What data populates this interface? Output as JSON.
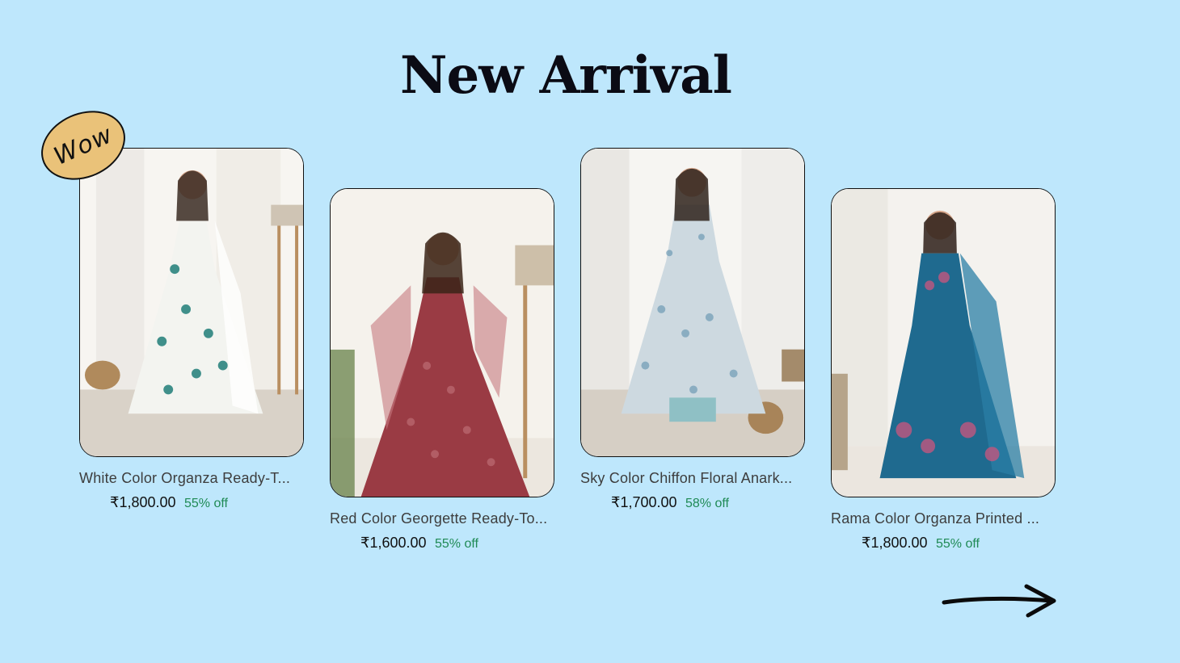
{
  "section": {
    "title": "New Arrival",
    "badge": "Wow"
  },
  "products": [
    {
      "name": "White Color Organza Ready-T...",
      "price": "₹1,800.00",
      "discount": "55% off",
      "dress_color": "#f3f4f0",
      "accent_color": "#3f8f8a"
    },
    {
      "name": "Red Color Georgette Ready-To...",
      "price": "₹1,600.00",
      "discount": "55% off",
      "dress_color": "#9a3b44",
      "accent_color": "#c77a80"
    },
    {
      "name": "Sky Color Chiffon Floral Anark...",
      "price": "₹1,700.00",
      "discount": "58% off",
      "dress_color": "#cdd9e0",
      "accent_color": "#6f9bb5"
    },
    {
      "name": "Rama Color Organza Printed ...",
      "price": "₹1,800.00",
      "discount": "55% off",
      "dress_color": "#1f6a8f",
      "accent_color": "#c2577f"
    }
  ],
  "navigation": {
    "next_icon": "arrow-right-icon"
  },
  "colors": {
    "background": "#bee7fc",
    "badge": "#eac279",
    "discount": "#1f8a55"
  }
}
